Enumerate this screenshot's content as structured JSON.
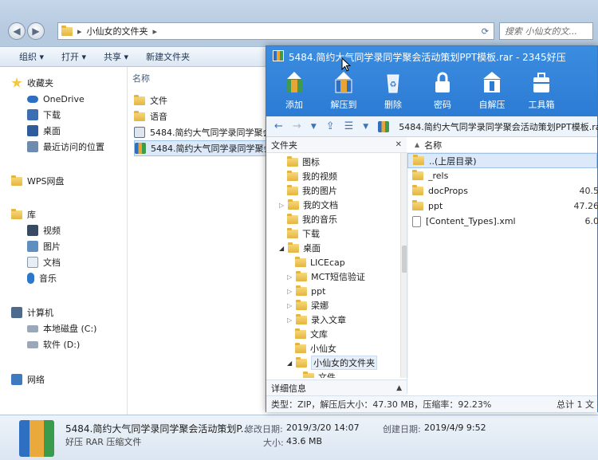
{
  "explorer": {
    "address_path": "小仙女的文件夹",
    "search_placeholder": "搜索 小仙女的文...",
    "toolbar": [
      "组织",
      "打开",
      "共享",
      "新建文件夹"
    ],
    "nav": {
      "favorites": "收藏夹",
      "onedrive": "OneDrive",
      "downloads": "下载",
      "desktop": "桌面",
      "recent": "最近访问的位置",
      "wps": "WPS网盘",
      "library": "库",
      "videos": "视频",
      "pictures": "图片",
      "documents": "文档",
      "music": "音乐",
      "computer": "计算机",
      "local_disk": "本地磁盘 (C:)",
      "soft_disk": "软件 (D:)",
      "network": "网络"
    },
    "column_name": "名称",
    "files": [
      "文件",
      "语音",
      "5484.简约大气同学录同学聚会",
      "5484.简约大气同学录同学聚会"
    ],
    "details": {
      "filename": "5484.简约大气同学录同学聚会活动策划P...",
      "type": "好压 RAR 压缩文件",
      "modified_label": "修改日期:",
      "modified": "2019/3/20 14:07",
      "created_label": "创建日期:",
      "created": "2019/4/9 9:52",
      "size_label": "大小:",
      "size": "43.6 MB"
    }
  },
  "rar": {
    "title": "5484.简约大气同学录同学聚会活动策划PPT模板.rar - 2345好压",
    "tools": [
      "添加",
      "解压到",
      "删除",
      "密码",
      "自解压",
      "工具箱"
    ],
    "path": "5484.简约大气同学录同学聚会活动策划PPT模板.rar",
    "folder_header": "文件夹",
    "tree": [
      "图标",
      "我的视频",
      "我的图片",
      "我的文档",
      "我的音乐",
      "下载",
      "桌面",
      "LICEcap",
      "MCT短信验证",
      "ppt",
      "梁娜",
      "录入文章",
      "文库",
      "小仙女",
      "小仙女的文件夹",
      "文件"
    ],
    "detail_header": "详细信息",
    "list_header": "名称",
    "list": [
      {
        "name": "..(上层目录)",
        "size": ""
      },
      {
        "name": "_rels",
        "size": ""
      },
      {
        "name": "docProps",
        "size": "40.5"
      },
      {
        "name": "ppt",
        "size": "47.26"
      },
      {
        "name": "[Content_Types].xml",
        "size": "6.0"
      }
    ],
    "status_left": "类型：ZIP，解压后大小：47.30 MB，压缩率：92.23%",
    "status_right": "总计 1 文"
  },
  "colors": {
    "rar_blue": "#2c7bd4",
    "folder_yellow": "#e4b541",
    "selection": "#dbe9f9"
  }
}
